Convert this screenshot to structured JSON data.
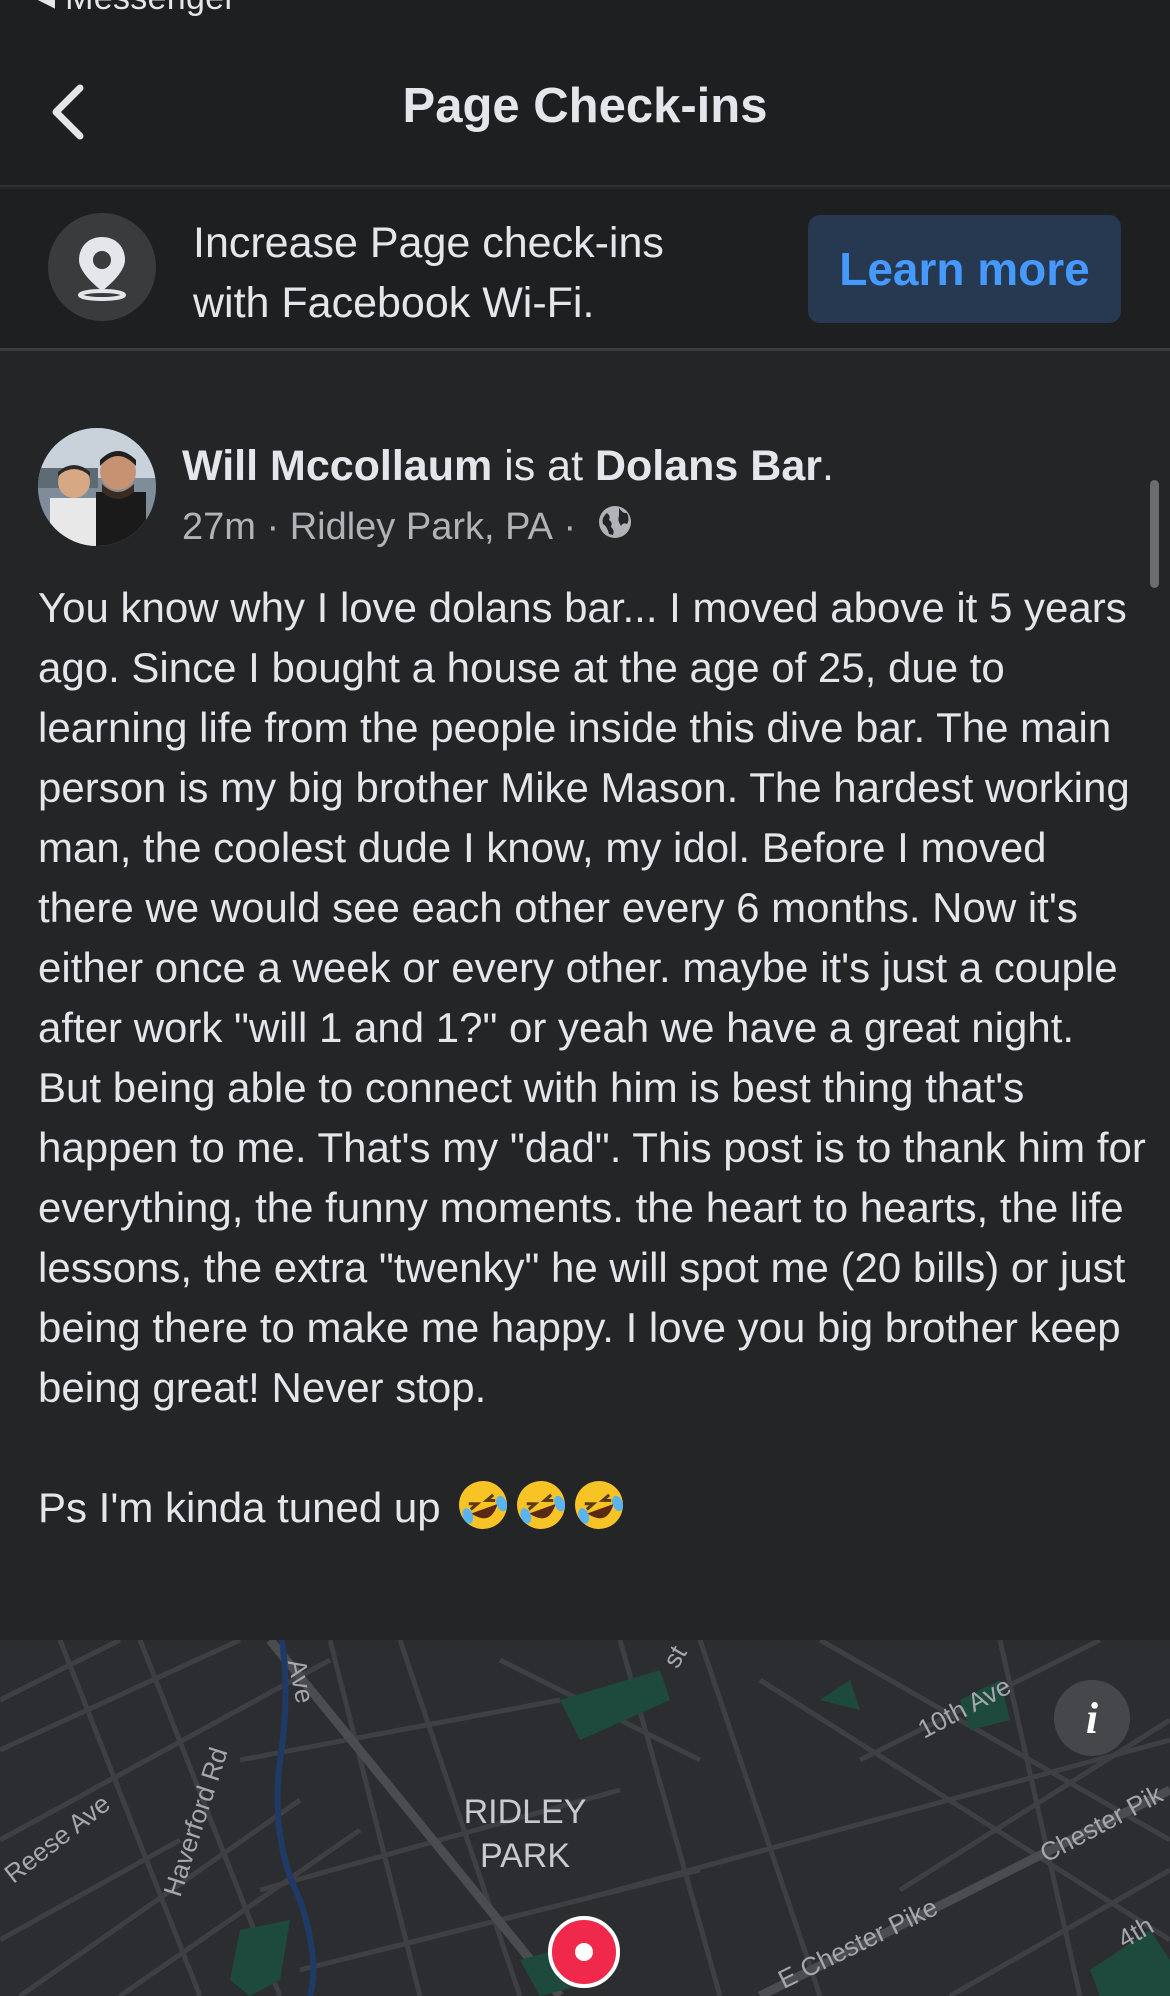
{
  "status_bar": {
    "back_app": "◂ Messenger"
  },
  "header": {
    "title": "Page Check-ins",
    "back_icon": "chevron-left-icon"
  },
  "promo": {
    "icon": "location-pin-icon",
    "line1": "Increase Page check-ins",
    "line2": "with Facebook Wi-Fi.",
    "button_label": "Learn more"
  },
  "post": {
    "author": "Will Mccollaum",
    "is_at": " is at ",
    "place": "Dolans Bar",
    "period": ".",
    "time": "27m",
    "separator": " · ",
    "location": "Ridley Park, PA",
    "separator2": " · ",
    "privacy_icon": "globe-icon",
    "body": "You know why I love dolans bar... I moved above it 5 years ago. Since I bought a house at the age of 25, due to learning life from the people inside this dive bar. The main person is my big brother Mike Mason. The hardest working man, the coolest dude I know, my idol. Before I moved there we would see each other every 6 months. Now it's either once a week or every other. maybe it's just a couple after work \"will 1 and 1?\" or yeah we have a great night. But being able to connect with him is best thing that's happen to me. That's my \"dad\". This post is to thank him for everything, the funny moments. the heart to hearts, the life lessons, the extra \"twenky\" he will spot me (20 bills) or just being there to make me happy. I love you big brother keep being great! Never stop.",
    "ps": "Ps I'm kinda tuned up",
    "emoji": "rolling-on-floor-laughing-emoji"
  },
  "map": {
    "streets": {
      "reese": "Reese Ave",
      "haverford": "Haverford Rd",
      "ave_fragment": "Ave",
      "st_fragment": "st",
      "tenth": "10th Ave",
      "chester_pike": "Chester Pik",
      "e_chester": "E Chester Pike",
      "fourth": "4th"
    },
    "place_line1": "RIDLEY",
    "place_line2": "PARK",
    "info_label": "i"
  }
}
